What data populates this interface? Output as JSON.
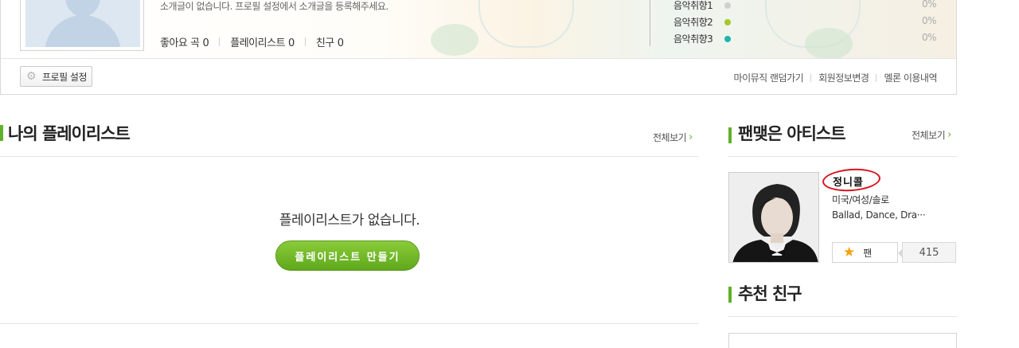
{
  "profile": {
    "intro": "소개글이 없습니다. 프로필 설정에서 소개글을 등록해주세요.",
    "stats": [
      {
        "label": "좋아요 곡",
        "value": "0"
      },
      {
        "label": "플레이리스트",
        "value": "0"
      },
      {
        "label": "친구",
        "value": "0"
      }
    ],
    "tastes": [
      {
        "label": "음악취향1",
        "percent": "0%",
        "color": "#cfcfcf"
      },
      {
        "label": "음악취향2",
        "percent": "0%",
        "color": "#a3c92c"
      },
      {
        "label": "음악취향3",
        "percent": "0%",
        "color": "#1eb4b0"
      }
    ],
    "settings_button": "프로필 설정",
    "links": [
      "마이뮤직 랜덤가기",
      "회원정보변경",
      "멜론 이용내역"
    ]
  },
  "playlist": {
    "title": "나의 플레이리스트",
    "more_label": "전체보기",
    "empty_message": "플레이리스트가 없습니다.",
    "create_button": "플레이리스트 만들기"
  },
  "fan_artist": {
    "title": "팬맺은 아티스트",
    "more_label": "전체보기",
    "artist": {
      "name": "정니콜",
      "info": "미국/여성/솔로",
      "genres": "Ballad, Dance, Dra···",
      "fan_button": "팬",
      "fan_count": "415"
    }
  },
  "friends": {
    "title": "추천 친구"
  },
  "colors": {
    "accent_green": "#5fb129",
    "annotation_red": "#d7141e",
    "star": "#f0a20f"
  }
}
